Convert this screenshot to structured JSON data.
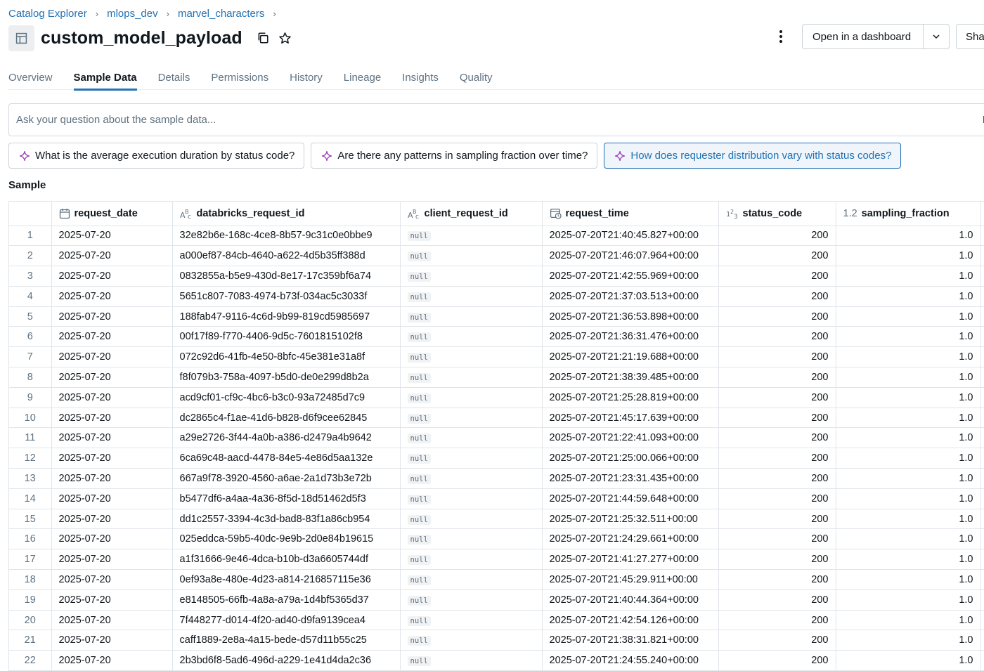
{
  "breadcrumb": [
    "Catalog Explorer",
    "mlops_dev",
    "marvel_characters"
  ],
  "title": "custom_model_payload",
  "actions": {
    "dashboard_label": "Open in a dashboard",
    "share_label": "Sha"
  },
  "tabs": [
    {
      "label": "Overview"
    },
    {
      "label": "Sample Data"
    },
    {
      "label": "Details"
    },
    {
      "label": "Permissions"
    },
    {
      "label": "History"
    },
    {
      "label": "Lineage"
    },
    {
      "label": "Insights"
    },
    {
      "label": "Quality"
    }
  ],
  "active_tab": "Sample Data",
  "ask": {
    "placeholder": "Ask your question about the sample data...",
    "trailing_text": "Be"
  },
  "suggestions": [
    "What is the average execution duration by status code?",
    "Are there any patterns in sampling fraction over time?",
    "How does requester distribution vary with status codes?"
  ],
  "selected_suggestion": 2,
  "section_label": "Sample",
  "table": {
    "columns": [
      {
        "name": "request_date",
        "type_icon": "calendar-icon"
      },
      {
        "name": "databricks_request_id",
        "type_icon": "string-type-icon"
      },
      {
        "name": "client_request_id",
        "type_icon": "string-type-icon"
      },
      {
        "name": "request_time",
        "type_icon": "datetime-icon"
      },
      {
        "name": "status_code",
        "type_icon": "integer-type-icon"
      },
      {
        "name": "sampling_fraction",
        "type_icon": "decimal-type-icon",
        "type_text": "1.2"
      }
    ],
    "null_text": "null",
    "rows": [
      [
        "1",
        "2025-07-20",
        "32e82b6e-168c-4ce8-8b57-9c31c0e0bbe9",
        "null",
        "2025-07-20T21:40:45.827+00:00",
        "200",
        "1.0"
      ],
      [
        "2",
        "2025-07-20",
        "a000ef87-84cb-4640-a622-4d5b35ff388d",
        "null",
        "2025-07-20T21:46:07.964+00:00",
        "200",
        "1.0"
      ],
      [
        "3",
        "2025-07-20",
        "0832855a-b5e9-430d-8e17-17c359bf6a74",
        "null",
        "2025-07-20T21:42:55.969+00:00",
        "200",
        "1.0"
      ],
      [
        "4",
        "2025-07-20",
        "5651c807-7083-4974-b73f-034ac5c3033f",
        "null",
        "2025-07-20T21:37:03.513+00:00",
        "200",
        "1.0"
      ],
      [
        "5",
        "2025-07-20",
        "188fab47-9116-4c6d-9b99-819cd5985697",
        "null",
        "2025-07-20T21:36:53.898+00:00",
        "200",
        "1.0"
      ],
      [
        "6",
        "2025-07-20",
        "00f17f89-f770-4406-9d5c-7601815102f8",
        "null",
        "2025-07-20T21:36:31.476+00:00",
        "200",
        "1.0"
      ],
      [
        "7",
        "2025-07-20",
        "072c92d6-41fb-4e50-8bfc-45e381e31a8f",
        "null",
        "2025-07-20T21:21:19.688+00:00",
        "200",
        "1.0"
      ],
      [
        "8",
        "2025-07-20",
        "f8f079b3-758a-4097-b5d0-de0e299d8b2a",
        "null",
        "2025-07-20T21:38:39.485+00:00",
        "200",
        "1.0"
      ],
      [
        "9",
        "2025-07-20",
        "acd9cf01-cf9c-4bc6-b3c0-93a72485d7c9",
        "null",
        "2025-07-20T21:25:28.819+00:00",
        "200",
        "1.0"
      ],
      [
        "10",
        "2025-07-20",
        "dc2865c4-f1ae-41d6-b828-d6f9cee62845",
        "null",
        "2025-07-20T21:45:17.639+00:00",
        "200",
        "1.0"
      ],
      [
        "11",
        "2025-07-20",
        "a29e2726-3f44-4a0b-a386-d2479a4b9642",
        "null",
        "2025-07-20T21:22:41.093+00:00",
        "200",
        "1.0"
      ],
      [
        "12",
        "2025-07-20",
        "6ca69c48-aacd-4478-84e5-4e86d5aa132e",
        "null",
        "2025-07-20T21:25:00.066+00:00",
        "200",
        "1.0"
      ],
      [
        "13",
        "2025-07-20",
        "667a9f78-3920-4560-a6ae-2a1d73b3e72b",
        "null",
        "2025-07-20T21:23:31.435+00:00",
        "200",
        "1.0"
      ],
      [
        "14",
        "2025-07-20",
        "b5477df6-a4aa-4a36-8f5d-18d51462d5f3",
        "null",
        "2025-07-20T21:44:59.648+00:00",
        "200",
        "1.0"
      ],
      [
        "15",
        "2025-07-20",
        "dd1c2557-3394-4c3d-bad8-83f1a86cb954",
        "null",
        "2025-07-20T21:25:32.511+00:00",
        "200",
        "1.0"
      ],
      [
        "16",
        "2025-07-20",
        "025eddca-59b5-40dc-9e9b-2d0e84b19615",
        "null",
        "2025-07-20T21:24:29.661+00:00",
        "200",
        "1.0"
      ],
      [
        "17",
        "2025-07-20",
        "a1f31666-9e46-4dca-b10b-d3a6605744df",
        "null",
        "2025-07-20T21:41:27.277+00:00",
        "200",
        "1.0"
      ],
      [
        "18",
        "2025-07-20",
        "0ef93a8e-480e-4d23-a814-216857115e36",
        "null",
        "2025-07-20T21:45:29.911+00:00",
        "200",
        "1.0"
      ],
      [
        "19",
        "2025-07-20",
        "e8148505-66fb-4a8a-a79a-1d4bf5365d37",
        "null",
        "2025-07-20T21:40:44.364+00:00",
        "200",
        "1.0"
      ],
      [
        "20",
        "2025-07-20",
        "7f448277-d014-4f20-ad40-d9fa9139cea4",
        "null",
        "2025-07-20T21:42:54.126+00:00",
        "200",
        "1.0"
      ],
      [
        "21",
        "2025-07-20",
        "caff1889-2e8a-4a15-bede-d57d11b55c25",
        "null",
        "2025-07-20T21:38:31.821+00:00",
        "200",
        "1.0"
      ],
      [
        "22",
        "2025-07-20",
        "2b3bd6f8-5ad6-496d-a229-1e41d4da2c36",
        "null",
        "2025-07-20T21:24:55.240+00:00",
        "200",
        "1.0"
      ]
    ]
  },
  "colors": {
    "link": "#2272b4",
    "text": "#11171c",
    "muted": "#5f7281",
    "border": "#e0e5ea"
  }
}
